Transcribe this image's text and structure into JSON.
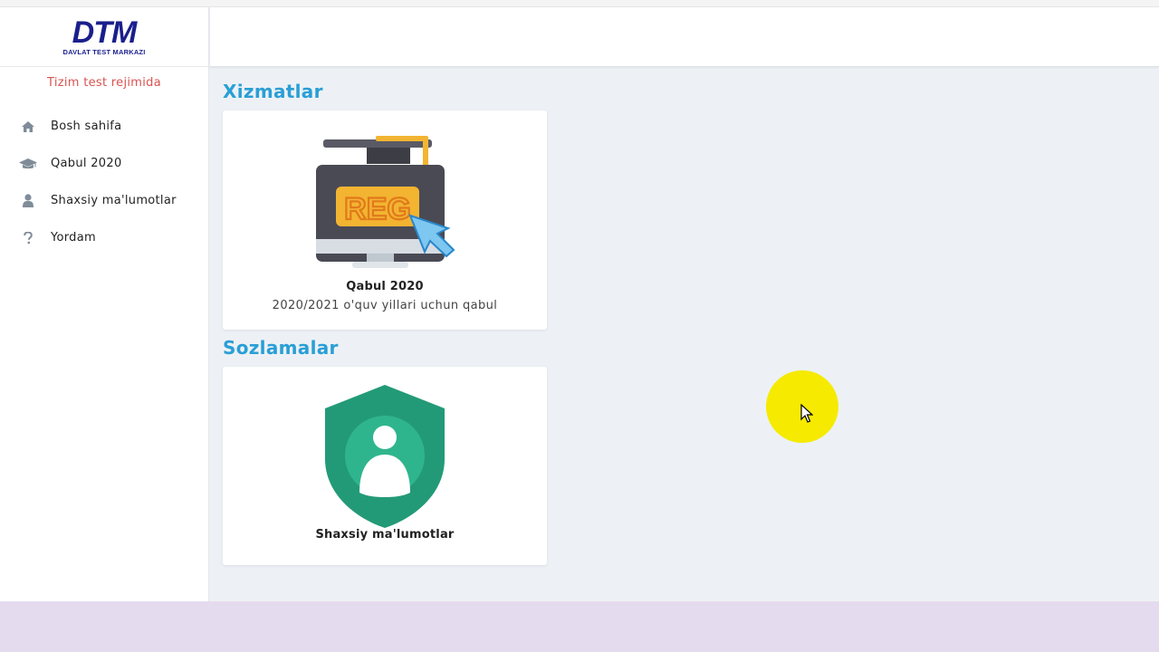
{
  "logo": {
    "text": "DTM",
    "subtitle": "DAVLAT TEST MARKAZI"
  },
  "sidebar": {
    "status_text": "Tizim test rejimida",
    "items": [
      {
        "label": "Bosh sahifa",
        "icon": "home-icon"
      },
      {
        "label": "Qabul 2020",
        "icon": "graduation-cap-icon"
      },
      {
        "label": "Shaxsiy ma'lumotlar",
        "icon": "user-icon"
      },
      {
        "label": "Yordam",
        "icon": "question-icon"
      }
    ]
  },
  "main": {
    "sections": [
      {
        "title": "Xizmatlar",
        "cards": [
          {
            "title": "Qabul 2020",
            "description": "2020/2021 o'quv yillari uchun qabul",
            "illustration_text": "REG",
            "icon": "registration-monitor-icon"
          }
        ]
      },
      {
        "title": "Sozlamalar",
        "cards": [
          {
            "title": "Shaxsiy ma'lumotlar",
            "icon": "user-shield-icon"
          }
        ]
      }
    ]
  },
  "colors": {
    "accent": "#2a9fd6",
    "warning_text": "#d9534f",
    "brand": "#1a1f8c",
    "shield": "#239a77",
    "cursor_highlight": "#f5ea00"
  }
}
